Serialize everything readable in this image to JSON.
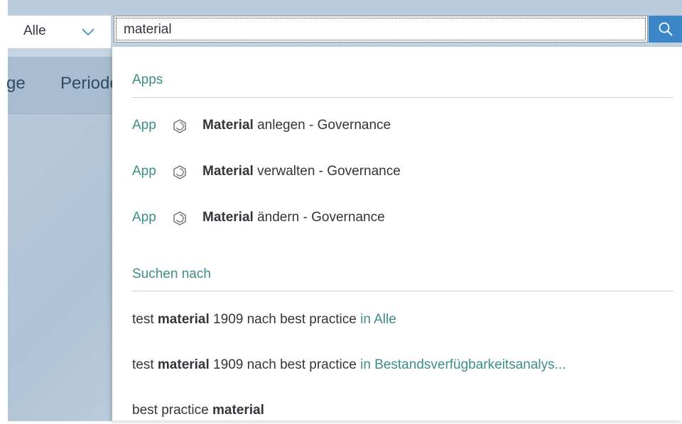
{
  "search": {
    "scope_label": "Alle",
    "query": "material"
  },
  "background_tabs": [
    "ge",
    "Periode"
  ],
  "dropdown": {
    "apps_heading": "Apps",
    "apps": [
      {
        "kind": "App",
        "bold": "Material",
        "rest": " anlegen - Governance"
      },
      {
        "kind": "App",
        "bold": "Material",
        "rest": " verwalten - Governance"
      },
      {
        "kind": "App",
        "bold": "Material",
        "rest": " ändern - Governance"
      }
    ],
    "search_heading": "Suchen nach",
    "suggestions": [
      {
        "pre": "test ",
        "bold": "material",
        "post": " 1909 nach best practice ",
        "scope": "in Alle"
      },
      {
        "pre": "test ",
        "bold": "material",
        "post": " 1909 nach best practice ",
        "scope": "in Bestandsverfügbarkeitsanalys..."
      },
      {
        "pre": "best practice ",
        "bold": "material",
        "post": "",
        "scope": ""
      }
    ]
  },
  "colors": {
    "accent_link": "#3e8d89",
    "search_button": "#3b86c6",
    "shell_bg": "#b7c9da"
  },
  "icons": {
    "chevron": "chevron-down-icon",
    "search": "search-icon",
    "app": "app-tile-icon"
  }
}
